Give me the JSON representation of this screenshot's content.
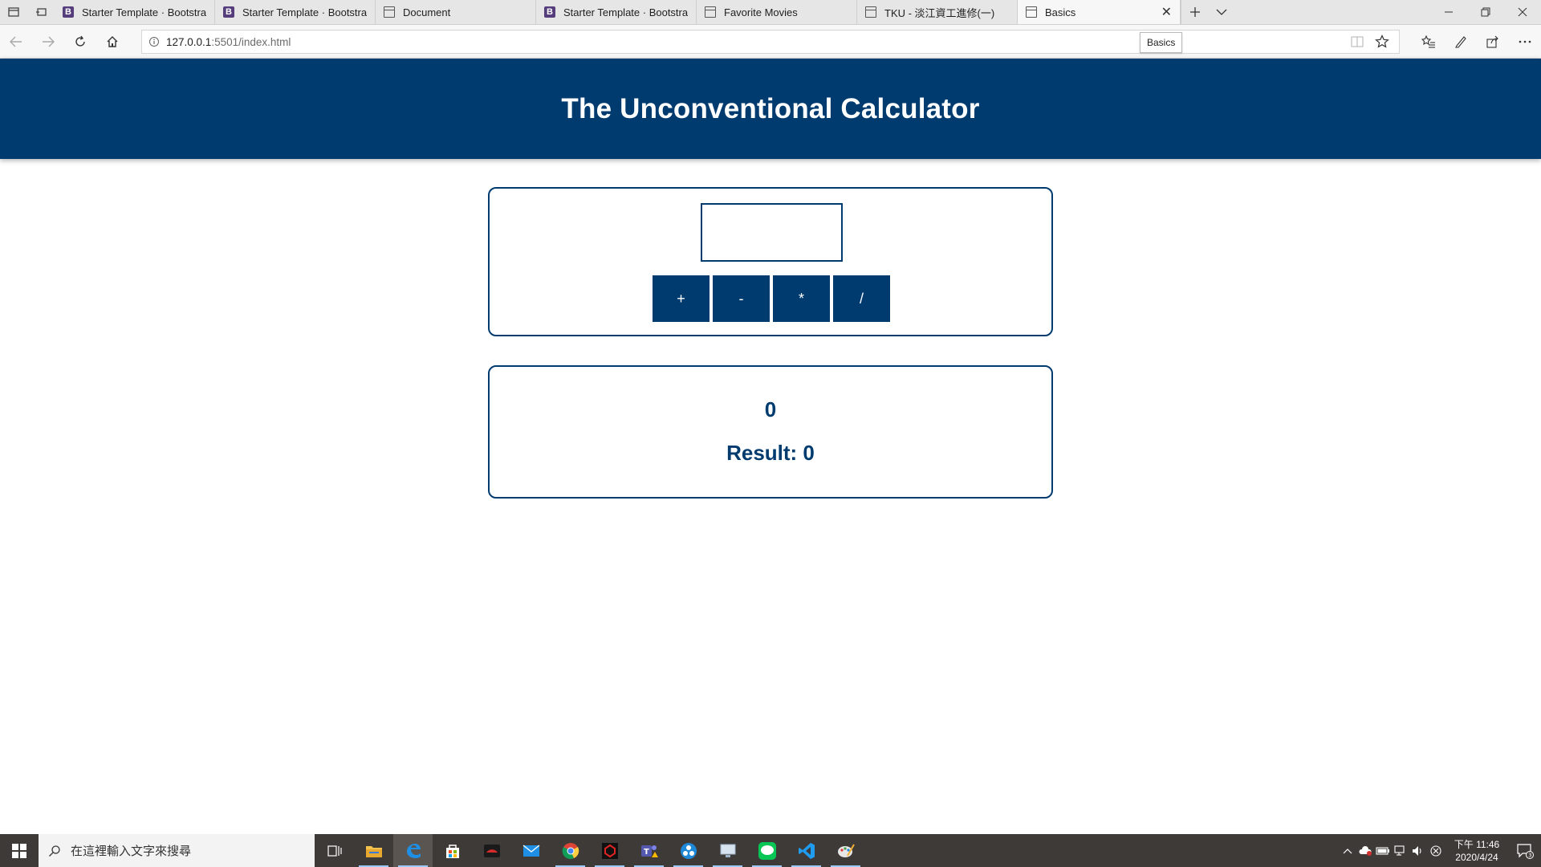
{
  "browser": {
    "tabs": [
      {
        "title": "Starter Template · Bootstrap",
        "icon": "bootstrap-icon"
      },
      {
        "title": "Starter Template · Bootstrap",
        "icon": "bootstrap-icon"
      },
      {
        "title": "Document",
        "icon": "page-icon"
      },
      {
        "title": "Starter Template · Bootstrap",
        "icon": "bootstrap-icon"
      },
      {
        "title": "Favorite Movies",
        "icon": "page-icon"
      },
      {
        "title": "TKU - 淡江資工進修(一)",
        "icon": "page-icon"
      },
      {
        "title": "Basics",
        "icon": "page-icon",
        "active": true
      }
    ],
    "address": {
      "host": "127.0.0.1",
      "rest": ":5501/index.html"
    },
    "tooltip": "Basics"
  },
  "page": {
    "title": "The Unconventional Calculator",
    "input": {
      "value": ""
    },
    "operators": [
      "+",
      "-",
      "*",
      "/"
    ],
    "current_value": "0",
    "result_text": "Result: 0"
  },
  "taskbar": {
    "search_placeholder": "在這裡輸入文字來搜尋",
    "time": "下午 11:46",
    "date": "2020/4/24",
    "notifications": "3"
  },
  "colors": {
    "accent": "#003b6f"
  }
}
